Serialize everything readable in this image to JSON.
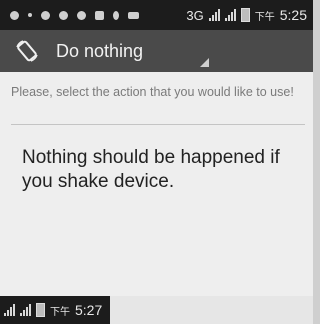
{
  "status_bar": {
    "network": "3G",
    "ampm": "下午",
    "time": "5:25"
  },
  "action_bar": {
    "mode_label": "Do nothing",
    "icon": "screen-rotation-icon"
  },
  "content": {
    "hint": "Please, select the action that you would like to use!",
    "message": "Nothing should be happened if you shake device."
  },
  "bottom_status": {
    "ampm": "下午",
    "time": "5:27"
  }
}
